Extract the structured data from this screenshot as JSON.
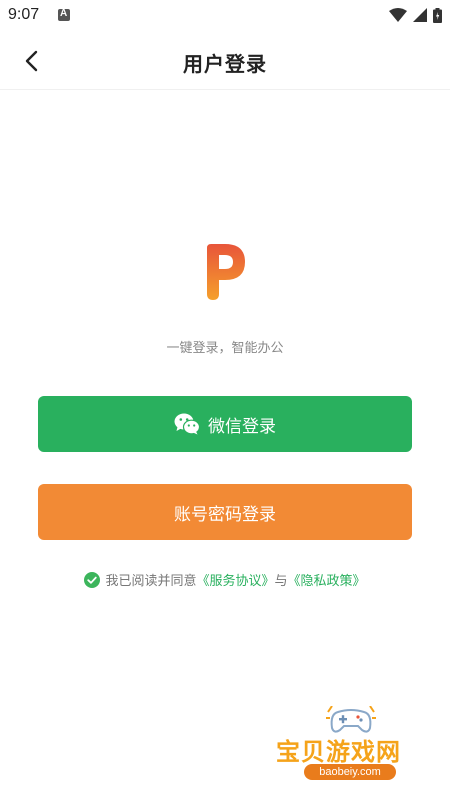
{
  "status_bar": {
    "time": "9:07",
    "icons": [
      "app-notification-icon",
      "wifi-icon",
      "signal-icon",
      "battery-icon"
    ]
  },
  "header": {
    "title": "用户登录",
    "back_icon": "chevron-left-icon"
  },
  "logo": {
    "letter": "P",
    "colors": {
      "top": "#e8553a",
      "bottom": "#f5a02c"
    }
  },
  "tagline": "一键登录，智能办公",
  "buttons": {
    "wechat_label": "微信登录",
    "account_label": "账号密码登录"
  },
  "agreement": {
    "prefix": "我已阅读并同意",
    "service_link": "《服务协议》",
    "joiner": "与",
    "privacy_link": "《隐私政策》"
  },
  "colors": {
    "wechat_green": "#29b05e",
    "account_orange": "#f28a35",
    "link_green": "#29b05e"
  },
  "watermark": {
    "text": "宝贝游戏网",
    "url": "baobeiy.com"
  }
}
